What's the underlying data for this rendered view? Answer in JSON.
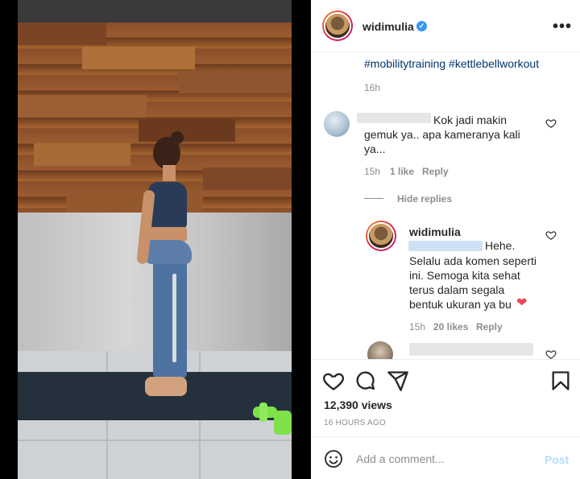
{
  "post": {
    "username": "widimulia",
    "verified_symbol": "✓",
    "more_icon": "•••"
  },
  "caption": {
    "hashtags": "#mobilitytraining #kettlebellworkout",
    "time": "16h"
  },
  "comments": [
    {
      "text_lines": [
        "Kok jadi makin",
        "gemuk ya.. apa kameranya kali",
        "ya..."
      ],
      "time": "15h",
      "likes": "1 like",
      "reply_label": "Reply"
    }
  ],
  "hide_replies_label": "Hide replies",
  "reply": {
    "username": "widimulia",
    "text_lines": [
      "Hehe.",
      "Selalu ada komen seperti",
      "ini. Semoga kita sehat",
      "terus dalam segala",
      "bentuk ukuran ya bu"
    ],
    "heart_emoji": "❤",
    "time": "15h",
    "likes": "20 likes",
    "reply_label": "Reply"
  },
  "stats": {
    "views": "12,390 views",
    "time_ago": "16 HOURS AGO"
  },
  "add_comment": {
    "placeholder": "Add a comment...",
    "post_label": "Post"
  },
  "icons": [
    "heart-icon",
    "comment-icon",
    "share-icon",
    "bookmark-icon",
    "emoji-icon",
    "more-icon",
    "verified-icon"
  ],
  "colors": {
    "link": "#00376b",
    "secondary_text": "#8e8e8e",
    "post_button_disabled": "#b2dffc",
    "verified": "#3897f0",
    "heart_red": "#ed4956"
  }
}
